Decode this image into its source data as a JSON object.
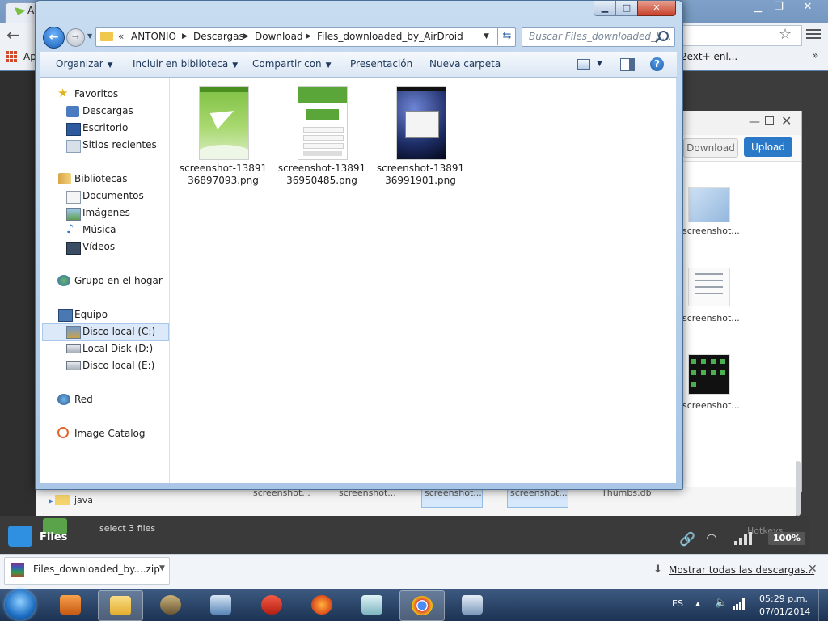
{
  "chrome": {
    "tab_title": "A",
    "apps_label": "Ap",
    "bookmark_right": "2ext+ enl...",
    "bookmark_more": "»"
  },
  "airdroid": {
    "download_label": "Download",
    "upload_label": "Upload",
    "thumb_names": [
      "screenshot...",
      "screenshot...",
      "screenshot..."
    ],
    "list_names": [
      "screenshot...",
      "screenshot...",
      "screenshot...",
      "screenshot...",
      "Thumbs.db"
    ],
    "folder_name": "java",
    "files_label": "Files",
    "status": "select 3 files",
    "hotkeys": "Hotkeys",
    "battery": "100%",
    "colors": {
      "upload": "#2a79c8"
    }
  },
  "explorer": {
    "breadcrumb": [
      "ANTONIO",
      "Descargas",
      "Download",
      "Files_downloaded_by_AirDroid"
    ],
    "search_placeholder": "Buscar Files_downloaded_b...",
    "commands": {
      "organize": "Organizar",
      "include": "Incluir en biblioteca",
      "share": "Compartir con",
      "slideshow": "Presentación",
      "new_folder": "Nueva carpeta"
    },
    "nav": {
      "favorites": "Favoritos",
      "downloads": "Descargas",
      "desktop": "Escritorio",
      "recent": "Sitios recientes",
      "libraries": "Bibliotecas",
      "documents": "Documentos",
      "pictures": "Imágenes",
      "music": "Música",
      "videos": "Vídeos",
      "homegroup": "Grupo en el hogar",
      "computer": "Equipo",
      "drive_c": "Disco local (C:)",
      "drive_d": "Local Disk (D:)",
      "drive_e": "Disco local (E:)",
      "network": "Red",
      "image_catalog": "Image Catalog"
    },
    "files": [
      {
        "line1": "screenshot-13891",
        "line2": "36897093.png"
      },
      {
        "line1": "screenshot-13891",
        "line2": "36950485.png"
      },
      {
        "line1": "screenshot-13891",
        "line2": "36991901.png"
      }
    ]
  },
  "download_shelf": {
    "item_name": "Files_downloaded_by....zip",
    "show_all": "Mostrar todas las descargas..."
  },
  "taskbar": {
    "language": "ES",
    "time": "05:29 p.m.",
    "date": "07/01/2014"
  }
}
